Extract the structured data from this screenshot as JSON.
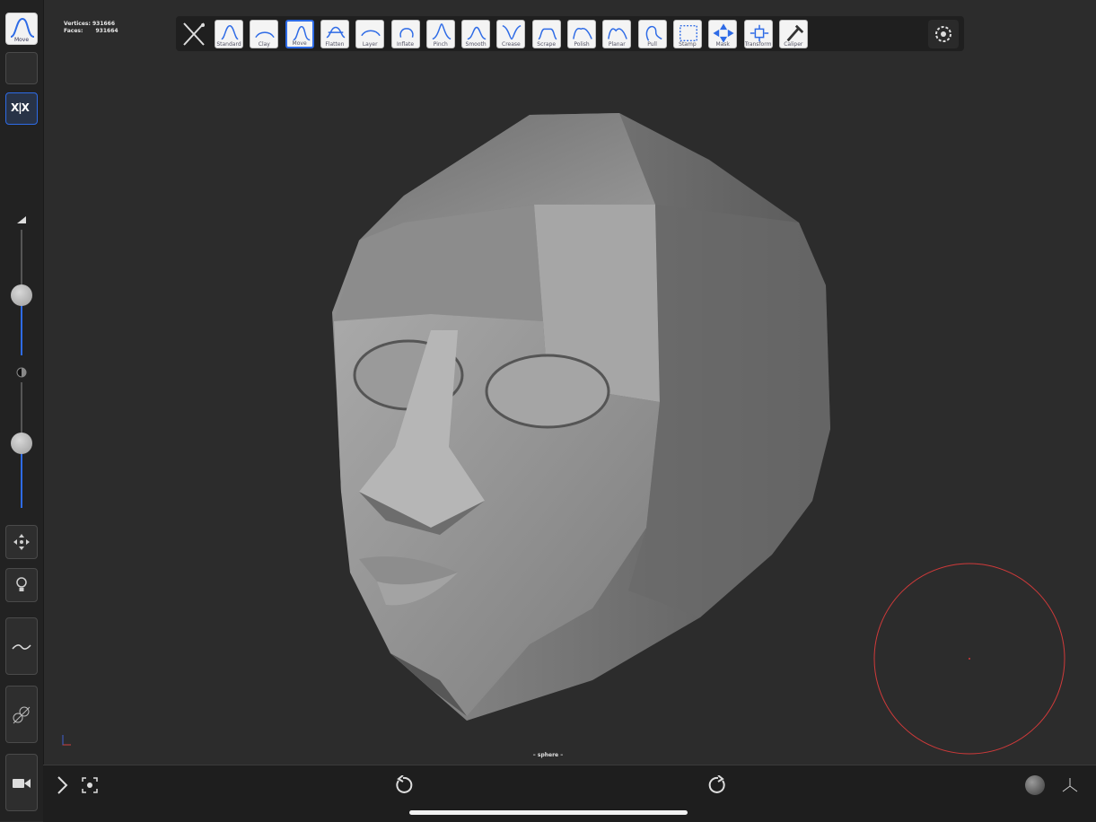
{
  "stats": {
    "vertices_label": "Vertices:",
    "vertices_value": "931666",
    "faces_label": "Faces:",
    "faces_value": "931664"
  },
  "sidebar": {
    "active_tool_label": "Move",
    "symmetry_label": "X|X",
    "radius_level": 0.45,
    "intensity_level": 0.43
  },
  "toolbar": {
    "tools": [
      "Standard",
      "Clay",
      "Move",
      "Flatten",
      "Layer",
      "Inflate",
      "Pinch",
      "Smooth",
      "Crease",
      "Scrape",
      "Polish",
      "Planar",
      "Pull",
      "Stamp",
      "Mask",
      "Transform",
      "Caliper"
    ],
    "active_tool": "Move"
  },
  "bottom": {
    "mesh_name": "– sphere –"
  },
  "colors": {
    "accent": "#2e6be6",
    "brush_cursor": "#d03a3a",
    "background": "#2c2c2c"
  }
}
